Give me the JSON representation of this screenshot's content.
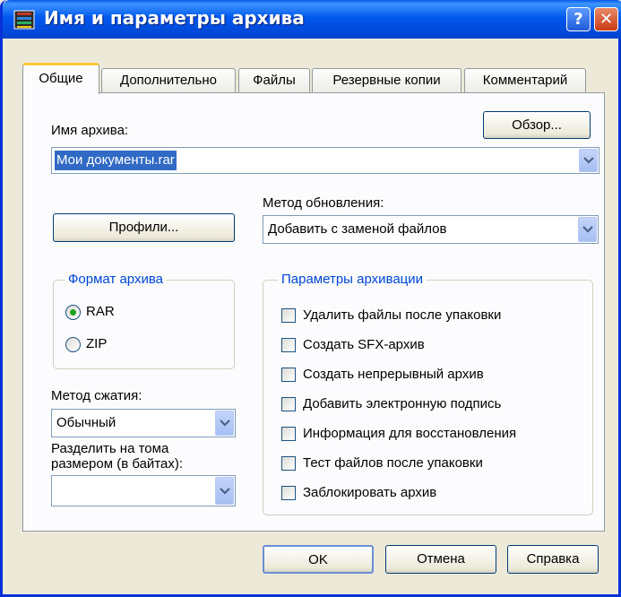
{
  "window": {
    "title": "Имя и параметры архива",
    "help_glyph": "?",
    "close_glyph": "✕"
  },
  "tabs": [
    {
      "label": "Общие",
      "active": true
    },
    {
      "label": "Дополнительно",
      "active": false
    },
    {
      "label": "Файлы",
      "active": false
    },
    {
      "label": "Резервные копии",
      "active": false
    },
    {
      "label": "Комментарий",
      "active": false
    }
  ],
  "archive": {
    "name_label": "Имя архива:",
    "browse_label": "Обзор...",
    "name_value": "Мои документы.rar"
  },
  "update": {
    "label": "Метод обновления:",
    "value": "Добавить с заменой файлов"
  },
  "profiles_label": "Профили...",
  "format": {
    "title": "Формат архива",
    "options": [
      {
        "label": "RAR",
        "selected": true
      },
      {
        "label": "ZIP",
        "selected": false
      }
    ]
  },
  "compression": {
    "label": "Метод сжатия:",
    "value": "Обычный"
  },
  "split": {
    "label_line1": "Разделить на тома",
    "label_line2": "размером (в байтах):",
    "value": ""
  },
  "options": {
    "title": "Параметры архивации",
    "items": [
      {
        "label": "Удалить файлы после упаковки",
        "checked": false
      },
      {
        "label": "Создать SFX-архив",
        "checked": false
      },
      {
        "label": "Создать непрерывный архив",
        "checked": false
      },
      {
        "label": "Добавить электронную подпись",
        "checked": false
      },
      {
        "label": "Информация для восстановления",
        "checked": false
      },
      {
        "label": "Тест файлов после упаковки",
        "checked": false
      },
      {
        "label": "Заблокировать архив",
        "checked": false
      }
    ]
  },
  "footer": {
    "ok_label": "OK",
    "cancel_label": "Отмена",
    "help_label": "Справка"
  },
  "colors": {
    "titlebar": "#0058ee",
    "dialog_bg": "#ece9d8",
    "group_title": "#0046d5",
    "selection": "#316ac5"
  }
}
